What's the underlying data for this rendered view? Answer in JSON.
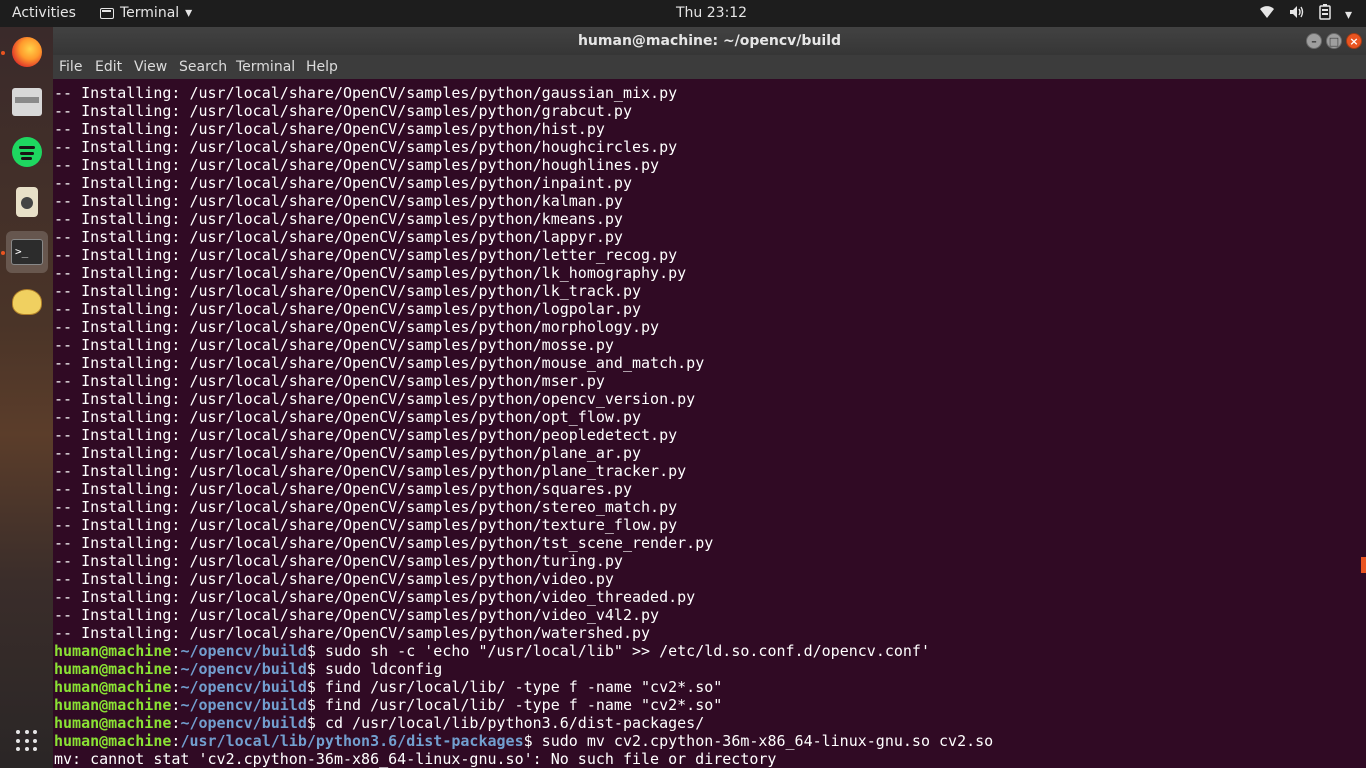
{
  "topbar": {
    "activities": "Activities",
    "app_menu": "Terminal",
    "app_menu_arrow": "▾",
    "clock": "Thu 23:12",
    "tray": {
      "wifi_icon": "wifi-icon",
      "volume_icon": "volume-icon",
      "battery_icon": "battery-icon",
      "menu_arrow": "▾"
    }
  },
  "dock": {
    "items": [
      {
        "name": "firefox",
        "icon": "firefox-icon"
      },
      {
        "name": "files",
        "icon": "files-icon"
      },
      {
        "name": "spotify",
        "icon": "spotify-icon"
      },
      {
        "name": "speaker-app",
        "icon": "speaker-icon"
      },
      {
        "name": "terminal",
        "icon": "terminal-icon",
        "active": true
      },
      {
        "name": "teapot-app",
        "icon": "teapot-icon"
      },
      {
        "name": "show-applications",
        "icon": "app-grid-icon"
      }
    ],
    "terminal_glyph": ">_"
  },
  "window": {
    "title": "human@machine: ~/opencv/build",
    "controls": {
      "minimize": "–",
      "maximize": "□",
      "close": "×"
    },
    "menu": [
      "File",
      "Edit",
      "View",
      "Search",
      "Terminal",
      "Help"
    ]
  },
  "terminal": {
    "top_fragment": "-- Installing: /usr/local/share/OpenCV/samples/python/gaussian_mix.py",
    "install_prefix": "-- Installing: /usr/local/share/OpenCV/samples/python/",
    "installed_files": [
      "gaussian_mix.py",
      "grabcut.py",
      "hist.py",
      "houghcircles.py",
      "houghlines.py",
      "inpaint.py",
      "kalman.py",
      "kmeans.py",
      "lappyr.py",
      "letter_recog.py",
      "lk_homography.py",
      "lk_track.py",
      "logpolar.py",
      "morphology.py",
      "mosse.py",
      "mouse_and_match.py",
      "mser.py",
      "opencv_version.py",
      "opt_flow.py",
      "peopledetect.py",
      "plane_ar.py",
      "plane_tracker.py",
      "squares.py",
      "stereo_match.py",
      "texture_flow.py",
      "tst_scene_render.py",
      "turing.py",
      "video.py",
      "video_threaded.py",
      "video_v4l2.py",
      "watershed.py"
    ],
    "user_host": "human@machine",
    "commands": [
      {
        "path": "~/opencv/build",
        "cmd": "sudo sh -c 'echo \"/usr/local/lib\" >> /etc/ld.so.conf.d/opencv.conf'"
      },
      {
        "path": "~/opencv/build",
        "cmd": "sudo ldconfig"
      },
      {
        "path": "~/opencv/build",
        "cmd": "find /usr/local/lib/ -type f -name \"cv2*.so\""
      },
      {
        "path": "~/opencv/build",
        "cmd": "find /usr/local/lib/ -type f -name \"cv2*.so\""
      },
      {
        "path": "~/opencv/build",
        "cmd": "cd /usr/local/lib/python3.6/dist-packages/"
      },
      {
        "path": "/usr/local/lib/python3.6/dist-packages",
        "cmd": "sudo mv cv2.cpython-36m-x86_64-linux-gnu.so cv2.so"
      }
    ],
    "error_line": "mv: cannot stat 'cv2.cpython-36m-x86_64-linux-gnu.so': No such file or directory"
  },
  "colors": {
    "terminal_bg": "#300a24",
    "prompt_user": "#8ae234",
    "prompt_path": "#729fcf",
    "accent": "#e95420"
  }
}
